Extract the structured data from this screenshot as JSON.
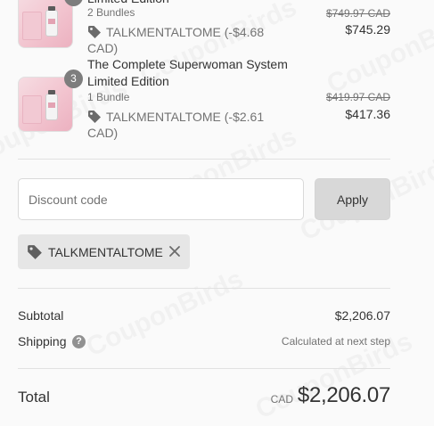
{
  "items": [
    {
      "title": "Limited Edition",
      "subtitle": "2 Bundles",
      "discount": "TALKMENTALTOME (-$4.68 CAD)",
      "original_price": "$749.97 CAD",
      "price": "$745.29"
    },
    {
      "quantity": "3",
      "title": "The Complete Superwoman System Limited Edition",
      "subtitle": "1 Bundle",
      "discount": "TALKMENTALTOME (-$2.61 CAD)",
      "original_price": "$419.97 CAD",
      "price": "$417.36"
    }
  ],
  "discount_code": {
    "placeholder": "Discount code",
    "value": "",
    "apply_label": "Apply"
  },
  "applied_code": {
    "label": "TALKMENTALTOME",
    "icon": "tag-icon",
    "remove_icon": "close-icon"
  },
  "summary": {
    "subtotal_label": "Subtotal",
    "subtotal_value": "$2,206.07",
    "shipping_label": "Shipping",
    "shipping_help_icon": "question-icon",
    "shipping_value": "Calculated at next step",
    "total_label": "Total",
    "currency": "CAD",
    "total_value": "$2,206.07"
  },
  "watermark": "CouponBirds",
  "colors": {
    "background": "#fafafa",
    "text": "#333333",
    "muted": "#737373",
    "chip_bg": "#e6e6e6",
    "button_bg": "#d8d8d8",
    "badge": "#7d7d7d",
    "divider": "#e1e1e1"
  }
}
